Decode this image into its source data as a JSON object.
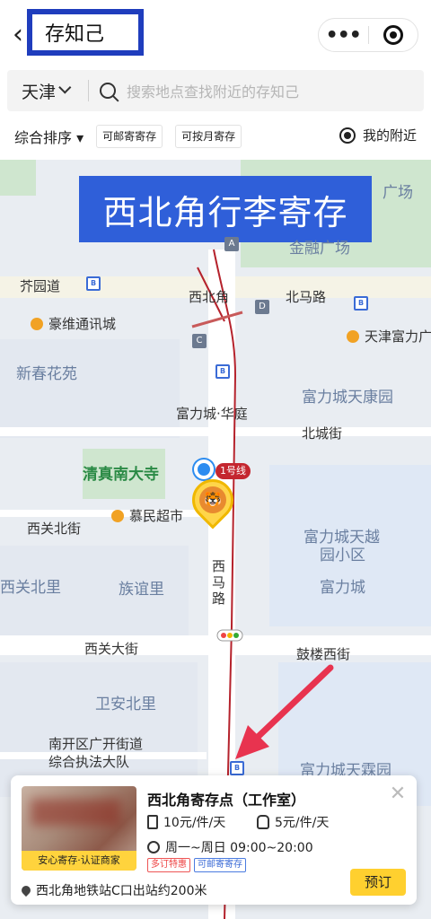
{
  "nav": {
    "back_icon": "chevron-left-icon",
    "title": "存知己",
    "more_icon": "more-dots-icon",
    "more_glyph": "•••",
    "close_icon": "target-close-icon"
  },
  "search": {
    "city": "天津",
    "placeholder": "搜索地点查找附近的存知己"
  },
  "filter": {
    "sort_label": "综合排序 ▾",
    "tags": [
      "可邮寄寄存",
      "可按月寄存"
    ],
    "nearby_label": "我的附近"
  },
  "map": {
    "banner": "西北角行李寄存",
    "labels": {
      "guangchang": "广场",
      "jinrun": "金融广场",
      "jieyuan": "芥园道",
      "xibeijiao": "西北角",
      "beimalu": "北马路",
      "haowei": "豪维通讯城",
      "tianjinfuli": "天津富力广",
      "xinchun": "新春花苑",
      "fulitiankang": "富力城天康园",
      "fuli_huating": "富力城·华庭",
      "beichengjie": "北城街",
      "qingzhen": "清真南大寺",
      "line1": "1号线",
      "muminchaoshi": "慕民超市",
      "xiguanbei": "西关北街",
      "fulitianyue": "富力城天越",
      "xiaoqu": "园小区",
      "fulicheng": "富力城",
      "xibeili": "西关北里",
      "zuyili": "族谊里",
      "ximalu": "西马路",
      "xiguandajie": "西关大街",
      "gulouxijie": "鼓楼西街",
      "weianbeili": "卫安北里",
      "nankai1": "南开区广开街道",
      "nankai2": "综合执法大队",
      "fulitianlin": "富力城天霖园"
    },
    "metro_letters": [
      "A",
      "D",
      "C"
    ]
  },
  "card": {
    "name": "西北角寄存点（工作室）",
    "thumb_caption": "安心寄存·认证商家",
    "price_bag": "10元/件/天",
    "price_pack": "5元/件/天",
    "hours": "周一~周日 09:00~20:00",
    "tag_red": "多订特惠",
    "tag_blue": "可邮寄寄存",
    "address": "西北角地铁站C口出站约200米",
    "book_label": "预订",
    "close_glyph": "✕"
  },
  "colors": {
    "accent_yellow": "#ffd02f",
    "banner_blue": "#2f5fd9",
    "title_border": "#1f3dbd",
    "metro_red": "#c4262f"
  }
}
